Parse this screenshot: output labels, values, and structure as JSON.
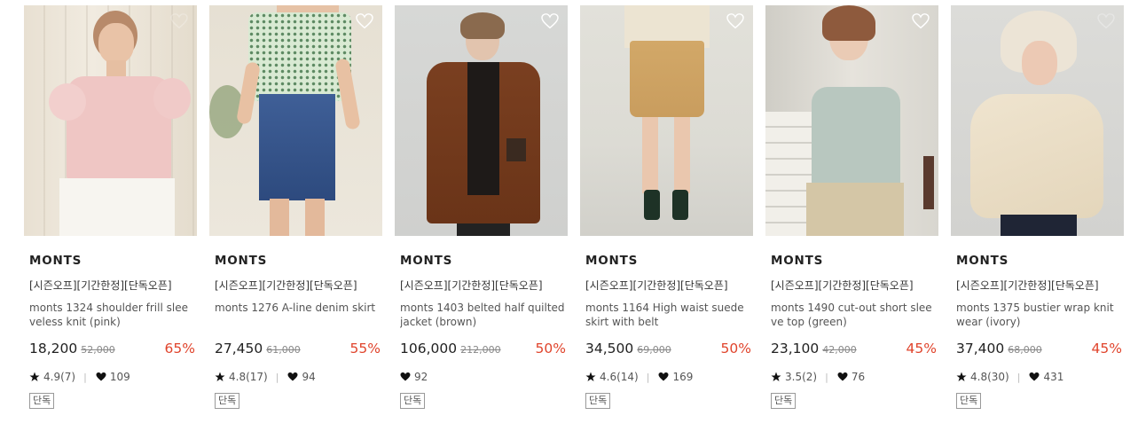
{
  "products": [
    {
      "brand": "MONTS",
      "tags": "[시즌오프][기간한정][단독오픈]",
      "name": "monts 1324 shoulder frill sleeveless knit (pink)",
      "price": "18,200",
      "original_price": "52,000",
      "discount": "65%",
      "rating": "4.9(7)",
      "likes": "109",
      "badge": "단독",
      "image": "model in pink frill sleeve knit"
    },
    {
      "brand": "MONTS",
      "tags": "[시즌오프][기간한정][단독오픈]",
      "name": "monts 1276 A-line denim skirt",
      "price": "27,450",
      "original_price": "61,000",
      "discount": "55%",
      "rating": "4.8(17)",
      "likes": "94",
      "badge": "단독",
      "image": "model in denim A-line skirt"
    },
    {
      "brand": "MONTS",
      "tags": "[시즌오프][기간한정][단독오픈]",
      "name": "monts 1403 belted half quilted jacket (brown)",
      "price": "106,000",
      "original_price": "212,000",
      "discount": "50%",
      "rating": "",
      "likes": "92",
      "badge": "단독",
      "image": "model in brown quilted jacket"
    },
    {
      "brand": "MONTS",
      "tags": "[시즌오프][기간한정][단독오픈]",
      "name": "monts 1164 High waist suede skirt with belt",
      "price": "34,500",
      "original_price": "69,000",
      "discount": "50%",
      "rating": "4.6(14)",
      "likes": "169",
      "badge": "단독",
      "image": "model in camel suede skirt"
    },
    {
      "brand": "MONTS",
      "tags": "[시즌오프][기간한정][단독오픈]",
      "name": "monts 1490 cut-out short sleeve top (green)",
      "price": "23,100",
      "original_price": "42,000",
      "discount": "45%",
      "rating": "3.5(2)",
      "likes": "76",
      "badge": "단독",
      "image": "model in mint green top"
    },
    {
      "brand": "MONTS",
      "tags": "[시즌오프][기간한정][단독오픈]",
      "name": "monts 1375 bustier wrap knitwear (ivory)",
      "price": "37,400",
      "original_price": "68,000",
      "discount": "45%",
      "rating": "4.8(30)",
      "likes": "431",
      "badge": "단독",
      "image": "model in ivory wrap knit"
    }
  ],
  "colors": {
    "discount": "#e0442c",
    "text": "#222222",
    "muted": "#888888"
  }
}
